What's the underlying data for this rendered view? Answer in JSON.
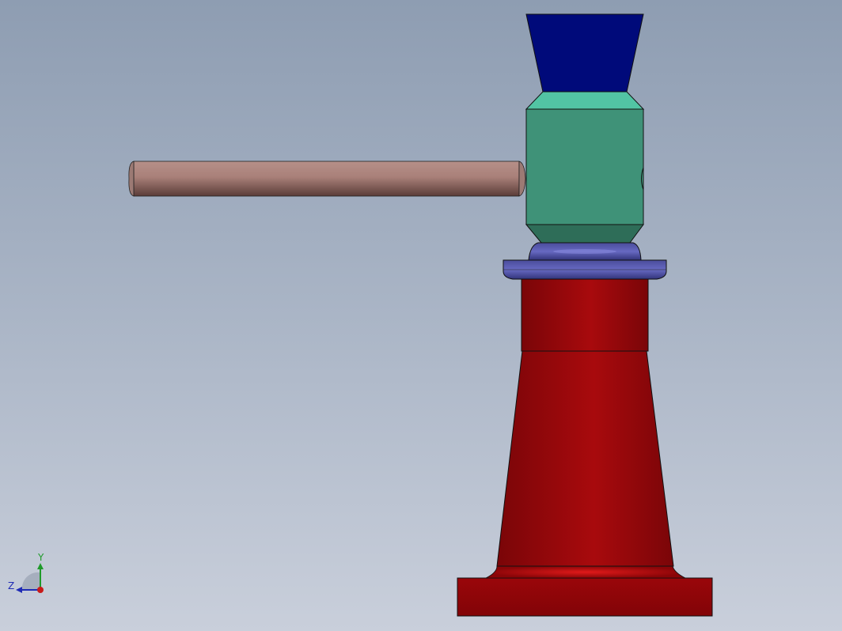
{
  "viewport": {
    "background_top": "#8e9db2",
    "background_bottom": "#c9cfdb"
  },
  "model": {
    "parts": [
      {
        "name": "top-cap",
        "color": "#000a7a"
      },
      {
        "name": "nut-body",
        "color": "#3f9278"
      },
      {
        "name": "handle-bar",
        "color": "#a98079"
      },
      {
        "name": "washer",
        "color": "#4f52a6"
      },
      {
        "name": "screw-housing",
        "color": "#a8080d"
      },
      {
        "name": "base-cone",
        "color": "#a80a0d"
      },
      {
        "name": "base-plate",
        "color": "#8e0508"
      }
    ]
  },
  "triad": {
    "y_label": "Y",
    "z_label": "Z",
    "y_color": "#1f9a2a",
    "z_color": "#1f2bb5",
    "x_color": "#c81a1a"
  }
}
